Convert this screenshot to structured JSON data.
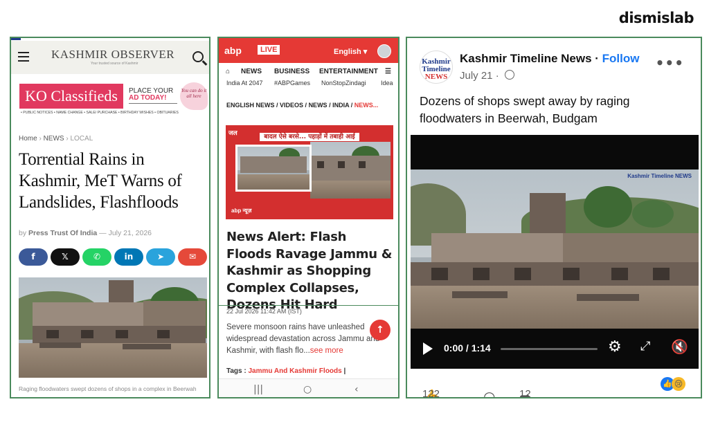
{
  "brand": "dismislab",
  "panel1": {
    "logo": "KASHMIR OBSERVER",
    "tagline": "Your trusted source of Kashmir",
    "classifieds": "KO Classifieds",
    "place_ad": "PLACE YOUR",
    "place_ad2": "AD TODAY!",
    "bubble": "You can do it all here",
    "services": "• PUBLIC NOTICES • NAME CHANGE • SALE/ PURCHASE • BIRTHDAY WISHES • OBITUARIES",
    "breadcrumb": [
      "Home",
      "NEWS",
      "LOCAL"
    ],
    "title": "Torrential Rains in Kashmir, MeT Warns of Landslides, Flashfloods",
    "byline_prefix": "by",
    "author": "Press Trust Of India",
    "date": "July 21, 2026",
    "share": [
      {
        "icon": "facebook-icon",
        "glyph": "f",
        "color": "#3b5998"
      },
      {
        "icon": "x-icon",
        "glyph": "𝕏",
        "color": "#111111"
      },
      {
        "icon": "whatsapp-icon",
        "glyph": "✆",
        "color": "#25d366"
      },
      {
        "icon": "linkedin-icon",
        "glyph": "in",
        "color": "#0077b5"
      },
      {
        "icon": "telegram-icon",
        "glyph": "➤",
        "color": "#2aa3dc"
      },
      {
        "icon": "mail-icon",
        "glyph": "✉",
        "color": "#e5493a"
      }
    ],
    "caption": "Raging floodwaters swept dozens of shops in a complex in Beerwah"
  },
  "panel2": {
    "logo": "abp",
    "live": "LIVE",
    "language": "English",
    "nav": [
      "NEWS",
      "BUSINESS",
      "ENTERTAINMENT"
    ],
    "subnav": [
      "India At 2047",
      "#ABPGames",
      "NonStopZindagi",
      "Idea"
    ],
    "crumb": [
      "ENGLISH NEWS",
      "VIDEOS",
      "NEWS",
      "INDIA",
      "NEWS..."
    ],
    "thumb_headline": "बादल ऐसे बरसे... पहाड़ों में तबाही आई",
    "thumb_tag": "जल",
    "thumb_logo": "abp न्यूज़",
    "title": "News Alert: Flash Floods Ravage Jammu & Kashmir as Shopping Complex Collapses, Dozens Hit Hard",
    "date": "22 Jul 2026 11:42 AM (IST)",
    "body": "Severe monsoon rains have unleashed widespread devastation across Jammu and Kashmir, with flash flo...",
    "see_more": "see more",
    "tags_label": "Tags :",
    "tags_value": "Jammu And Kashmir Floods"
  },
  "panel3": {
    "avatar_line1": "Kashmir",
    "avatar_line2": "Timeline",
    "avatar_line3": "NEWS",
    "page_name": "Kashmir Timeline News",
    "follow": "Follow",
    "date": "July 21",
    "text": "Dozens of shops swept away by raging floodwaters in Beerwah, Budgam",
    "video_time": "0:00 / 1:14",
    "video_progress": 0.0,
    "watermark": "Kashmir Timeline NEWS",
    "likes": "122",
    "shares": "12"
  }
}
